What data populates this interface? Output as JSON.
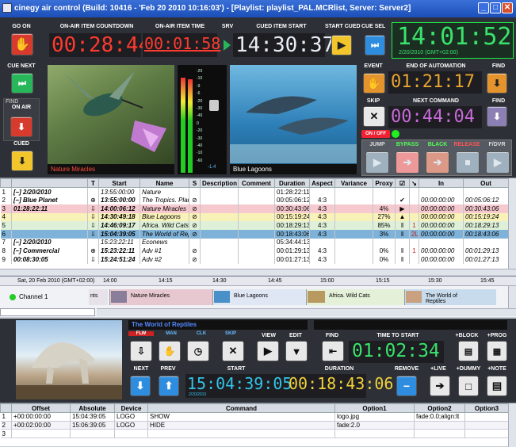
{
  "window": {
    "title": "cinegy air control (Build: 10416 - 'Feb 20 2010 10:16:03') - [Playlist: playlist_PAL.MCRlist, Server: Server2]"
  },
  "top": {
    "go_on": "GO ON",
    "countdown_label": "ON-AIR ITEM COUNTDOWN",
    "countdown": "00:28:44",
    "item_time_label": "ON-AIR ITEM TIME",
    "item_time": "00:01:58",
    "srv_label": "SRV",
    "cued_start_label": "CUED ITEM START",
    "cued_start": "14:30:37",
    "start_cued_label": "START CUED",
    "cue_sel_label": "CUE SEL",
    "clock": "14:01:52",
    "clock_date": "2/20/2010 (GMT+02:00)"
  },
  "left": {
    "cue_next": "CUE NEXT",
    "find": "FIND",
    "on_air": "ON AIR",
    "cued": "CUED"
  },
  "preview": {
    "left_caption": "Nature Miracles",
    "right_caption": "Blue Lagoons"
  },
  "vu": {
    "ticks": [
      "-20",
      "-10",
      "-9",
      "-6",
      "-20",
      "-30",
      "-40",
      "0",
      "-20",
      "-30",
      "-40",
      "-10",
      "-60"
    ],
    "readout": "-1.4"
  },
  "right": {
    "event": "EVENT",
    "end_auto_label": "END OF AUTOMATION",
    "end_auto": "01:21:17",
    "find": "FIND",
    "skip": "SKIP",
    "next_cmd_label": "NEXT COMMAND",
    "next_cmd": "00:44:04",
    "find2": "FIND",
    "on_off": "ON / OFF",
    "jump": "JUMP",
    "bypass": "BYPASS",
    "black": "BLACK",
    "release": "RELEASE",
    "fdvr": "F/DVR"
  },
  "playlist": {
    "headers": [
      "",
      "T",
      "Start",
      "Name",
      "S",
      "Description",
      "Comment",
      "Duration",
      "Aspect",
      "Variance",
      "Proxy",
      "☑",
      "↘",
      "In",
      "Out"
    ],
    "rows": [
      {
        "n": "1",
        "grp": "[–]  2/20/2010",
        "start": "13:55:00:00",
        "name": "Nature",
        "dur": "01:28:22:11",
        "bg": "#ffffff"
      },
      {
        "n": "2",
        "grp": "[–]  Blue Planet",
        "t": "⊕",
        "start": "13:55:00:00",
        "name": "The Tropics. Plan",
        "s": "⊘",
        "dur": "00:05:06:12",
        "asp": "4:3",
        "chk": "✔",
        "in": "00:00:00:00",
        "out": "00:05:06:12",
        "bg": "#ffffff",
        "bold": true
      },
      {
        "n": "3",
        "grp": "01:28:22:11",
        "t": "⇩",
        "start": "14:00:06:12",
        "name": "Nature Miracles",
        "s": "⊘",
        "dur": "00:30:43:06",
        "asp": "4:3",
        "proxy": "4%",
        "chk": "▶",
        "in": "00:00:00:00",
        "out": "00:30:43:06",
        "bg": "#f6c9cf",
        "bold": true
      },
      {
        "n": "4",
        "t": "⇩",
        "start": "14:30:49:18",
        "name": "Blue Lagoons",
        "s": "⊘",
        "dur": "00:15:19:24",
        "asp": "4:3",
        "proxy": "27%",
        "chk": "▲",
        "in": "00:00:00:00",
        "out": "00:15:19:24",
        "bg": "#f8f2b8",
        "bold": true
      },
      {
        "n": "5",
        "t": "⇩",
        "start": "14:46:09:17",
        "name": "Africa. Wild Cats",
        "s": "⊘",
        "dur": "00:18:29:13",
        "asp": "4:3",
        "proxy": "85%",
        "chk": "‖",
        "mk": "1",
        "in": "00:00:00:00",
        "out": "00:18:29:13",
        "bg": "#dff0d8",
        "bold": true
      },
      {
        "n": "6",
        "t": "⇩",
        "start": "15:04:39:05",
        "name": "The World of Rep",
        "s": "⊘",
        "dur": "00:18:43:06",
        "asp": "4:3",
        "proxy": "3%",
        "chk": "‖",
        "mk": "2L",
        "in": "00:00:00:00",
        "out": "00:18:43:06",
        "bg": "#7fb2d8",
        "bold": true
      },
      {
        "n": "7",
        "grp": "[–]  2/20/2010",
        "start": "15:23:22:11",
        "name": "Econews",
        "dur": "05:34:44:13",
        "bg": "#ffffff"
      },
      {
        "n": "8",
        "grp": "[–]  Commercial",
        "t": "⊕",
        "start": "15:23:22:11",
        "name": "Adv #1",
        "s": "⊘",
        "dur": "00:01:29:13",
        "asp": "4:3",
        "proxy": "0%",
        "chk": "‖",
        "mk": "1",
        "in": "00:00:00:00",
        "out": "00:01:29:13",
        "bg": "#ffffff",
        "bold": true
      },
      {
        "n": "9",
        "grp": "00:08:30:05",
        "t": "⇩",
        "start": "15:24:51:24",
        "name": "Adv #2",
        "s": "⊘",
        "dur": "00:01:27:13",
        "asp": "4:3",
        "proxy": "0%",
        "chk": "‖",
        "in": "00:00:00:00",
        "out": "00:01:27:13",
        "bg": "#ffffff",
        "bold": true
      }
    ]
  },
  "timeline": {
    "date": "Sat, 20 Feb 2010 (GMT+02:00)",
    "ticks": [
      "14:00",
      "14:15",
      "14:30",
      "14:45",
      "15:00",
      "15:15",
      "15:30",
      "15:45"
    ],
    "channel": "Channel 1",
    "clips": [
      {
        "label": "nts"
      },
      {
        "label": "Nature Miracles"
      },
      {
        "label": "Blue Lagoons"
      },
      {
        "label": "Africa. Wild Cats"
      },
      {
        "label": "The World of Reptiles"
      }
    ]
  },
  "item": {
    "title": "The World of Reptiles",
    "flags": [
      "FLW",
      "MAN",
      "CLK",
      "SKIP"
    ],
    "view": "VIEW",
    "edit": "EDIT",
    "find": "FIND",
    "time_to_start_label": "TIME TO START",
    "time_to_start": "01:02:34",
    "block": "+BLOCK",
    "prog": "+PROG",
    "next": "NEXT",
    "prev": "PREV",
    "start_label": "START",
    "start": "15:04:39:05",
    "start_date": "2/20/2010",
    "duration_label": "DURATION",
    "duration": "00:18:43:06",
    "remove": "REMOVE",
    "live": "+LIVE",
    "dummy": "+DUMMY",
    "note": "+NOTE"
  },
  "commands": {
    "headers": [
      "",
      "Offset",
      "Absolute",
      "Device",
      "Command",
      "Option1",
      "Option2",
      "Option3"
    ],
    "rows": [
      {
        "n": "1",
        "offset": "+00:00:00:00",
        "abs": "15:04:39:05",
        "dev": "LOGO",
        "cmd": "SHOW",
        "o1": "logo.jpg",
        "o2": "fade:0.0;align:lt",
        "o3": ""
      },
      {
        "n": "2",
        "offset": "+00:02:00:00",
        "abs": "15:06:39:05",
        "dev": "LOGO",
        "cmd": "HIDE",
        "o1": "fade:2.0",
        "o2": "",
        "o3": ""
      },
      {
        "n": "3",
        "offset": "",
        "abs": "",
        "dev": "",
        "cmd": "",
        "o1": "",
        "o2": "",
        "o3": ""
      }
    ]
  },
  "colors": {
    "clock_red": "#ff3b2f",
    "clock_yellow": "#f1d23a",
    "clock_cyan": "#31c5e8",
    "clock_green": "#39e36b",
    "accent": "#2a5ad8"
  }
}
